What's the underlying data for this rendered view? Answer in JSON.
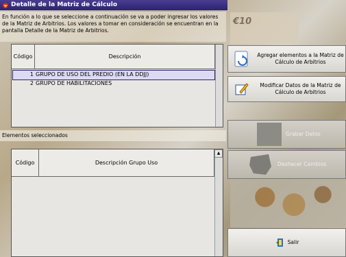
{
  "window": {
    "title": "Detalle de la Matriz de Cálculo"
  },
  "intro_text": "En función a lo que se seleccione a continuación se va a poder ingresar los valores de la Matriz de Arbitrios. Los valores a tomar en consideración se encuentran en la pantalla Detalle de la Matriz de Arbitrios.",
  "grid_top": {
    "headers": [
      "Código",
      "Descripción"
    ],
    "rows": [
      {
        "code": "1",
        "description": "GRUPO DE USO DEL PREDIO (EN LA DDJJ)"
      },
      {
        "code": "2",
        "description": "GRUPO DE HABILITACIONES"
      }
    ]
  },
  "selected_label": "Elementos seleccionados",
  "grid_bottom": {
    "headers": [
      "Código",
      "Descripción Grupo Uso"
    ]
  },
  "buttons": {
    "add": "Agregar elementos a la Matriz de Cálculo de Arbitrios",
    "modify": "Modificar Datos de la Matriz de Cálculo de Arbitrios",
    "save": "Grabar Datos",
    "undo": "Deshacer Cambios",
    "exit": "Salir"
  },
  "bg_text": {
    "note_code": "€10"
  },
  "colors": {
    "titlebar": "#2a2373",
    "selection": "#dcd9f3"
  }
}
